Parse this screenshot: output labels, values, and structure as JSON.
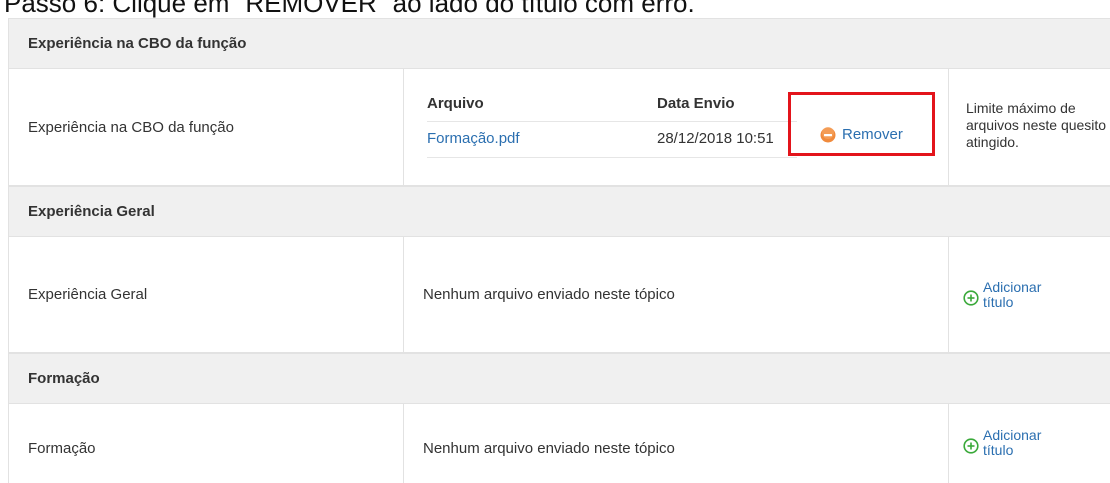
{
  "caption": "Passo 6: Clique em “REMOVER” ao lado do título com erro.",
  "colors": {
    "link": "#2b6fb0",
    "highlight": "#e3141b",
    "header_bg": "#f0f0f0",
    "remove_icon": "#f08a3c",
    "add_icon": "#3aa93a"
  },
  "sections": [
    {
      "title": "Experiência na CBO da função",
      "row_label": "Experiência na CBO da função",
      "files": {
        "headers": {
          "file": "Arquivo",
          "date": "Data Envio"
        },
        "items": [
          {
            "name": "Formação.pdf",
            "date": "28/12/2018 10:51",
            "remove_label": "Remover",
            "remove_icon": "minus-circle-icon"
          }
        ]
      },
      "side_text": "Limite máximo de arquivos neste quesito atingido."
    },
    {
      "title": "Experiência Geral",
      "row_label": "Experiência Geral",
      "empty_text": "Nenhum arquivo enviado neste tópico",
      "add_label": "Adicionar título",
      "add_icon": "plus-circle-icon"
    },
    {
      "title": "Formação",
      "row_label": "Formação",
      "empty_text": "Nenhum arquivo enviado neste tópico",
      "add_label": "Adicionar título",
      "add_icon": "plus-circle-icon"
    }
  ]
}
